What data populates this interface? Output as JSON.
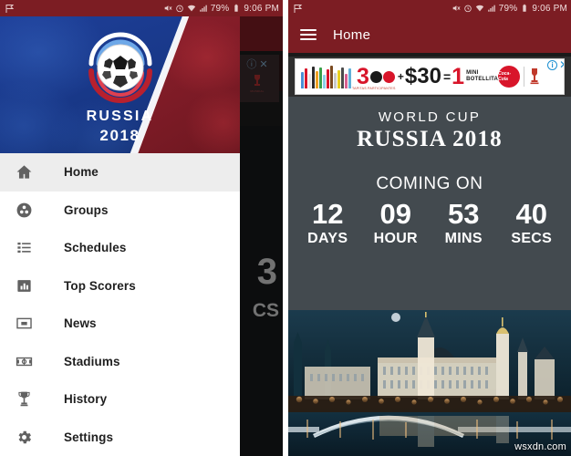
{
  "status_bar": {
    "icons": [
      "mute-icon",
      "alarm-icon",
      "wifi-icon",
      "signal-icon"
    ],
    "battery_percent": "79%",
    "time": "9:06 PM"
  },
  "drawer": {
    "header": {
      "logo": "fifa-world-cup-ball-logo",
      "title": "RUSSIA",
      "year": "2018"
    },
    "items": [
      {
        "label": "Home",
        "icon": "home-icon",
        "selected": true
      },
      {
        "label": "Groups",
        "icon": "groups-icon",
        "selected": false
      },
      {
        "label": "Schedules",
        "icon": "list-icon",
        "selected": false
      },
      {
        "label": "Top Scorers",
        "icon": "bar-chart-icon",
        "selected": false
      },
      {
        "label": "News",
        "icon": "news-icon",
        "selected": false
      },
      {
        "label": "Stadiums",
        "icon": "stadium-icon",
        "selected": false
      },
      {
        "label": "History",
        "icon": "trophy-icon",
        "selected": false
      },
      {
        "label": "Settings",
        "icon": "gear-icon",
        "selected": false
      }
    ]
  },
  "background_content": {
    "partial_number": "3",
    "partial_label": "CS"
  },
  "home": {
    "appbar": {
      "menu_icon": "hamburger-icon",
      "title": "Home"
    },
    "ad": {
      "offer_count": "3",
      "plus": "+",
      "price": "$30",
      "equals": "=",
      "reward_count": "1",
      "reward_line1": "MINI",
      "reward_line2": "BOTELLITA",
      "fine_print": "TAPITAS PARTICIPANTES",
      "brand": "Coca-Cola",
      "brand_tagline": "DESTAPA LA FELICIDAD",
      "sponsor": "MUNDIAL DE RUSIA 2018",
      "info_icon": "adchoices-info-icon",
      "close_icon": "close-icon"
    },
    "headline": {
      "line1": "WORLD CUP",
      "line2": "RUSSIA 2018",
      "coming": "COMING ON"
    },
    "countdown": [
      {
        "value": "12",
        "unit": "DAYS"
      },
      {
        "value": "09",
        "unit": "HOUR"
      },
      {
        "value": "53",
        "unit": "MINS"
      },
      {
        "value": "40",
        "unit": "SECS"
      }
    ],
    "hero_image": "moscow-kremlin-night-skyline"
  },
  "watermark": "wsxdn.com",
  "colors": {
    "appbar": "#7c1d23",
    "drawer_selected": "#ededed",
    "body": "#434a4f",
    "drawer_blue": "#1c3f94",
    "drawer_red": "#8e1f2c",
    "ad_accent": "#d8152a",
    "ad_control": "#1b8fd1"
  }
}
